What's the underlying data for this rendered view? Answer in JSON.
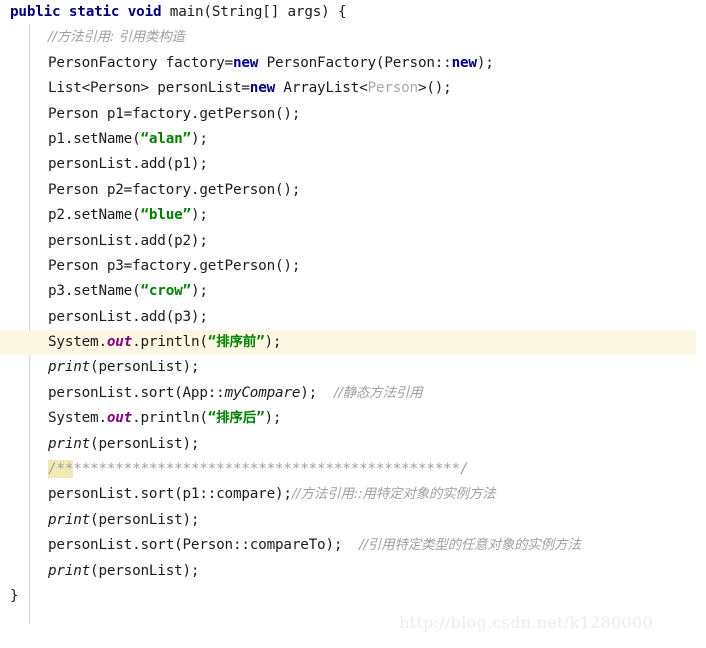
{
  "editor": {
    "language": "java",
    "theme": "light",
    "colors": {
      "background": "#ffffff",
      "foreground": "#1c1c1c",
      "keyword": "#000080",
      "string": "#008000",
      "comment": "#a0a0a0",
      "field": "#800080",
      "generic_type": "#a9a9a9",
      "current_line_highlight": "#fdf8e4",
      "brace_match_highlight": "#f3e9b5",
      "indent_guide": "#d8d8d8",
      "watermark": "#ebebeb"
    },
    "current_line_number": 14,
    "watermark": "http://blog.csdn.net/k1280000"
  },
  "code_lines": [
    {
      "n": 1,
      "indent": 0,
      "tokens": [
        {
          "t": "public",
          "c": "kw"
        },
        {
          "t": " ",
          "c": "plain"
        },
        {
          "t": "static",
          "c": "kw"
        },
        {
          "t": " ",
          "c": "plain"
        },
        {
          "t": "void",
          "c": "kw"
        },
        {
          "t": " main(String[] args) {",
          "c": "plain"
        }
      ]
    },
    {
      "n": 2,
      "indent": 1,
      "tokens": [
        {
          "t": "//方法引用: 引用类构造",
          "c": "cjk-cmt"
        }
      ]
    },
    {
      "n": 3,
      "indent": 1,
      "tokens": [
        {
          "t": "PersonFactory factory=",
          "c": "plain"
        },
        {
          "t": "new",
          "c": "kw"
        },
        {
          "t": " PersonFactory(Person::",
          "c": "plain"
        },
        {
          "t": "new",
          "c": "kw"
        },
        {
          "t": ");",
          "c": "plain"
        }
      ]
    },
    {
      "n": 4,
      "indent": 1,
      "tokens": [
        {
          "t": "List<Person> personList=",
          "c": "plain"
        },
        {
          "t": "new",
          "c": "kw"
        },
        {
          "t": " ArrayList<",
          "c": "plain"
        },
        {
          "t": "Person",
          "c": "gen"
        },
        {
          "t": ">();",
          "c": "plain"
        }
      ]
    },
    {
      "n": 5,
      "indent": 1,
      "tokens": [
        {
          "t": "Person p1=factory.getPerson();",
          "c": "plain"
        }
      ]
    },
    {
      "n": 6,
      "indent": 1,
      "tokens": [
        {
          "t": "p1.setName(",
          "c": "plain"
        },
        {
          "t": "“alan”",
          "c": "str"
        },
        {
          "t": ");",
          "c": "plain"
        }
      ]
    },
    {
      "n": 7,
      "indent": 1,
      "tokens": [
        {
          "t": "personList.add(p1);",
          "c": "plain"
        }
      ]
    },
    {
      "n": 8,
      "indent": 1,
      "tokens": [
        {
          "t": "Person p2=factory.getPerson();",
          "c": "plain"
        }
      ]
    },
    {
      "n": 9,
      "indent": 1,
      "tokens": [
        {
          "t": "p2.setName(",
          "c": "plain"
        },
        {
          "t": "“blue”",
          "c": "str"
        },
        {
          "t": ");",
          "c": "plain"
        }
      ]
    },
    {
      "n": 10,
      "indent": 1,
      "tokens": [
        {
          "t": "personList.add(p2);",
          "c": "plain"
        }
      ]
    },
    {
      "n": 11,
      "indent": 1,
      "tokens": [
        {
          "t": "Person p3=factory.getPerson();",
          "c": "plain"
        }
      ]
    },
    {
      "n": 12,
      "indent": 1,
      "tokens": [
        {
          "t": "p3.setName(",
          "c": "plain"
        },
        {
          "t": "“crow”",
          "c": "str"
        },
        {
          "t": ");",
          "c": "plain"
        }
      ]
    },
    {
      "n": 13,
      "indent": 1,
      "tokens": [
        {
          "t": "personList.add(p3);",
          "c": "plain"
        }
      ]
    },
    {
      "n": 14,
      "indent": 1,
      "current": true,
      "tokens": [
        {
          "t": "System.",
          "c": "plain"
        },
        {
          "t": "out",
          "c": "field"
        },
        {
          "t": ".println(",
          "c": "plain"
        },
        {
          "t": "“",
          "c": "str"
        },
        {
          "t": "排序前",
          "c": "str cjk"
        },
        {
          "t": "”",
          "c": "str"
        },
        {
          "t": ");",
          "c": "plain"
        }
      ]
    },
    {
      "n": 15,
      "indent": 1,
      "tokens": [
        {
          "t": "print",
          "c": "mth"
        },
        {
          "t": "(personList);",
          "c": "plain"
        }
      ]
    },
    {
      "n": 16,
      "indent": 1,
      "tokens": [
        {
          "t": "personList.sort(App::",
          "c": "plain"
        },
        {
          "t": "myCompare",
          "c": "mth"
        },
        {
          "t": ");  ",
          "c": "plain"
        },
        {
          "t": "//静态方法引用",
          "c": "cjk-cmt"
        }
      ]
    },
    {
      "n": 17,
      "indent": 1,
      "tokens": [
        {
          "t": "System.",
          "c": "plain"
        },
        {
          "t": "out",
          "c": "field"
        },
        {
          "t": ".println(",
          "c": "plain"
        },
        {
          "t": "“",
          "c": "str"
        },
        {
          "t": "排序后",
          "c": "str cjk"
        },
        {
          "t": "”",
          "c": "str"
        },
        {
          "t": ");",
          "c": "plain"
        }
      ]
    },
    {
      "n": 18,
      "indent": 1,
      "tokens": [
        {
          "t": "print",
          "c": "mth"
        },
        {
          "t": "(personList);",
          "c": "plain"
        }
      ]
    },
    {
      "n": 19,
      "indent": 1,
      "tokens": [
        {
          "t": "/**",
          "c": "cmt brace-hl"
        },
        {
          "t": "**********************************************/",
          "c": "cmt"
        }
      ]
    },
    {
      "n": 20,
      "indent": 1,
      "tokens": [
        {
          "t": "personList.sort(p1::compare);",
          "c": "plain"
        },
        {
          "t": "//方法引用::用特定对象的实例方法",
          "c": "cjk-cmt"
        }
      ]
    },
    {
      "n": 21,
      "indent": 1,
      "tokens": [
        {
          "t": "print",
          "c": "mth"
        },
        {
          "t": "(personList);",
          "c": "plain"
        }
      ]
    },
    {
      "n": 22,
      "indent": 1,
      "tokens": [
        {
          "t": "personList.sort(Person::compareTo);  ",
          "c": "plain"
        },
        {
          "t": "//引用特定类型的任意对象的实例方法",
          "c": "cjk-cmt"
        }
      ]
    },
    {
      "n": 23,
      "indent": 1,
      "tokens": [
        {
          "t": "print",
          "c": "mth"
        },
        {
          "t": "(personList);",
          "c": "plain"
        }
      ]
    },
    {
      "n": 24,
      "indent": 0,
      "tokens": [
        {
          "t": "}",
          "c": "plain"
        }
      ]
    }
  ]
}
